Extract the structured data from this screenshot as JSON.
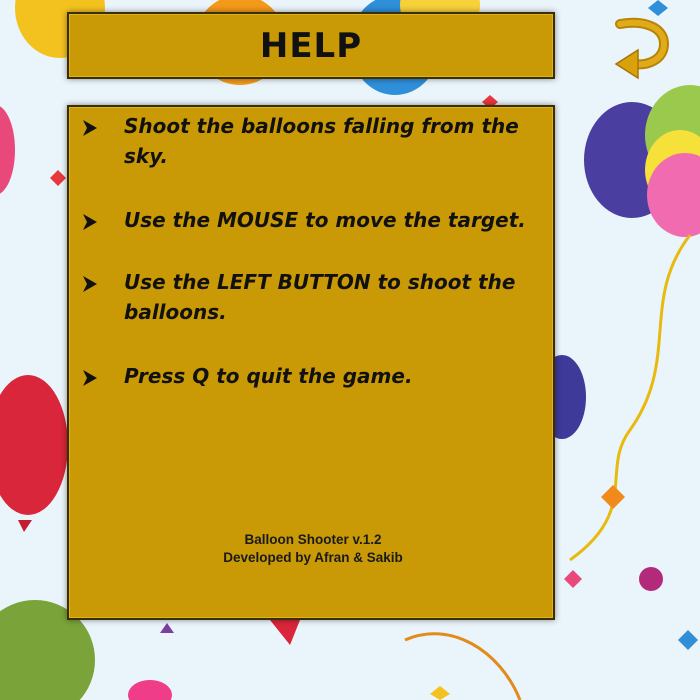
{
  "title": "HELP",
  "instructions": [
    "Shoot the balloons falling from the sky.",
    "Use the MOUSE to move the target.",
    "Use the LEFT BUTTON to shoot the balloons.",
    "Press Q to quit the game."
  ],
  "credits": {
    "version": "Balloon Shooter v.1.2",
    "developers": "Developed by Afran & Sakib"
  },
  "icons": {
    "back": "back-arrow-icon",
    "bullet": "arrow-bullet-icon"
  },
  "colors": {
    "panel": "#c99a05",
    "arrow": "#d9a20a",
    "text": "#111111"
  }
}
